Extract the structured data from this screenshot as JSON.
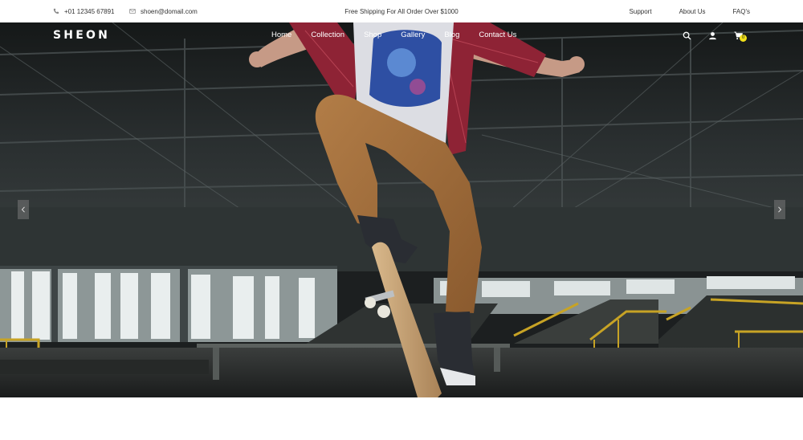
{
  "topbar": {
    "phone": "+01 12345 67891",
    "email": "shoen@domail.com",
    "promo": "Free Shipping For All Order Over $1000",
    "links": [
      "Support",
      "About Us",
      "FAQ's"
    ]
  },
  "header": {
    "logo": "SHEON",
    "nav": [
      "Home",
      "Collection",
      "Shop",
      "Gallery",
      "Blog",
      "Contact Us"
    ],
    "cart_count": "0"
  },
  "colors": {
    "accent": "#f2e11a",
    "hero_dark": "#1c1f20",
    "text_light": "#ffffff"
  },
  "icons": [
    "phone-icon",
    "mail-icon",
    "search-icon",
    "user-icon",
    "cart-icon",
    "chevron-left-icon",
    "chevron-right-icon"
  ]
}
